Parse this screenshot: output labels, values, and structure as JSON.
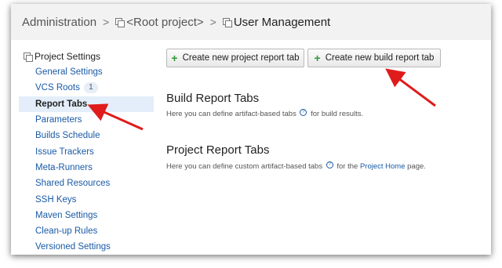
{
  "breadcrumb": {
    "root": "Administration",
    "project": "<Root project>",
    "current": "User Management",
    "separator": ">"
  },
  "sidebar": {
    "title": "Project Settings",
    "items": [
      {
        "label": "General Settings"
      },
      {
        "label": "VCS Roots",
        "badge": "1"
      },
      {
        "label": "Report Tabs",
        "active": true
      },
      {
        "label": "Parameters"
      },
      {
        "label": "Builds Schedule"
      },
      {
        "label": "Issue Trackers"
      },
      {
        "label": "Meta-Runners"
      },
      {
        "label": "Shared Resources"
      },
      {
        "label": "SSH Keys"
      },
      {
        "label": "Maven Settings"
      },
      {
        "label": "Clean-up Rules"
      },
      {
        "label": "Versioned Settings"
      }
    ]
  },
  "buttons": {
    "create_project_tab": "Create new project report tab",
    "create_build_tab": "Create new build report tab"
  },
  "build_section": {
    "title": "Build Report Tabs",
    "desc_before": "Here you can define artifact-based tabs",
    "desc_after": "for build results."
  },
  "project_section": {
    "title": "Project Report Tabs",
    "desc_before": "Here you can define custom artifact-based tabs",
    "desc_mid": "for the",
    "desc_link": "Project Home",
    "desc_after": "page."
  },
  "help_glyph": "?",
  "colors": {
    "link": "#1a5aa6",
    "active_bg": "#e3eefa",
    "arrow": "#e01b1b",
    "plus": "#2e9a3a"
  }
}
